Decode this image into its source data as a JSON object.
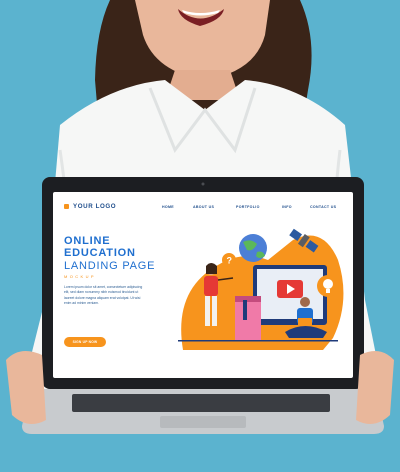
{
  "page": {
    "logo": {
      "text": "YOUR LOGO",
      "icon": "logo-square-icon",
      "accent": "#f7941d"
    },
    "nav": [
      {
        "label": "HOME"
      },
      {
        "label": "ABOUT US"
      },
      {
        "label": "PORTFOLIO"
      },
      {
        "label": "INFO"
      },
      {
        "label": "CONTACT US"
      }
    ],
    "hero": {
      "line1": "ONLINE",
      "line2": "EDUCATION",
      "line3": "LANDING PAGE",
      "tag": "MOCKUP",
      "body": "Lorem ipsum dolor sit amet, consectetuer adipiscing elit, sed diam nonummy nibh euismod tincidunt ut laoreet dolore magna aliquam erat volutpat. Ut wisi enim ad minim veniam.",
      "cta": "SIGN UP NOW"
    },
    "illustration": {
      "icons": [
        "globe-icon",
        "question-bubble-icon",
        "satellite-icon",
        "lightbulb-icon",
        "video-play-icon",
        "book-icon",
        "laptop-icon"
      ]
    },
    "colors": {
      "primary": "#1f6fcf",
      "accent": "#f7941d",
      "background": "#5bb3cf"
    }
  }
}
